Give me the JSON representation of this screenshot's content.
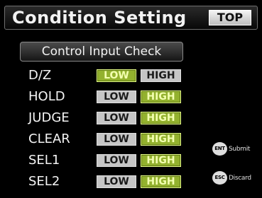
{
  "header": {
    "title": "Condition Setting",
    "top_label": "TOP"
  },
  "section": {
    "label": "Control Input Check"
  },
  "rows": [
    {
      "label": "D/Z",
      "low": "LOW",
      "high": "HIGH",
      "selected": "low"
    },
    {
      "label": "HOLD",
      "low": "LOW",
      "high": "HIGH",
      "selected": "high"
    },
    {
      "label": "JUDGE",
      "low": "LOW",
      "high": "HIGH",
      "selected": "high"
    },
    {
      "label": "CLEAR",
      "low": "LOW",
      "high": "HIGH",
      "selected": "high"
    },
    {
      "label": "SEL1",
      "low": "LOW",
      "high": "HIGH",
      "selected": "high"
    },
    {
      "label": "SEL2",
      "low": "LOW",
      "high": "HIGH",
      "selected": "high"
    }
  ],
  "keys": {
    "ent": {
      "badge": "ENT",
      "label": "Submit"
    },
    "esc": {
      "badge": "ESC",
      "label": "Discard"
    }
  },
  "colors": {
    "selected_bg": "#93b12e",
    "selected_text": "#f3ffb0",
    "unselected_bg": "#c6c6c6"
  }
}
